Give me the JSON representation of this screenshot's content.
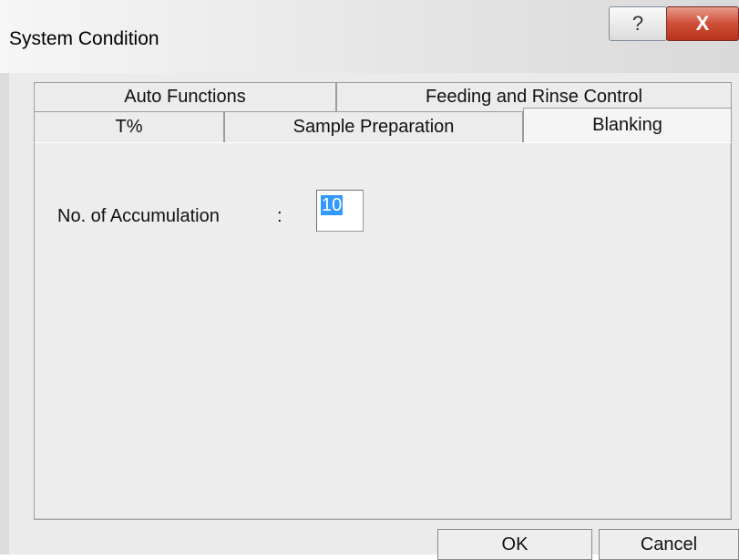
{
  "window": {
    "title": "System Condition",
    "help_glyph": "?",
    "close_glyph": "X"
  },
  "tabs": {
    "row1": [
      {
        "label": "Auto Functions"
      },
      {
        "label": "Feeding and Rinse Control"
      }
    ],
    "row2": [
      {
        "label": "T%"
      },
      {
        "label": "Sample Preparation"
      },
      {
        "label": "Blanking",
        "active": true
      }
    ]
  },
  "blanking": {
    "accumulation_label": "No. of Accumulation",
    "colon": ":",
    "accumulation_value": "10"
  },
  "buttons": {
    "ok": "OK",
    "cancel": "Cancel"
  },
  "colors": {
    "close_button": "#c9452d",
    "selection": "#3399ff"
  }
}
